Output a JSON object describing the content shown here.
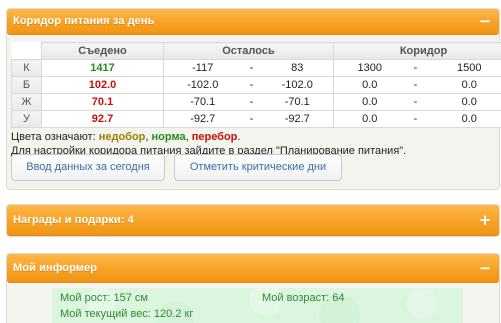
{
  "corridor_panel": {
    "title": "Коридор питания за день",
    "toggle": "−",
    "table": {
      "headers": {
        "eaten": "Съедено",
        "remaining": "Осталось",
        "corridor": "Коридор"
      },
      "rows": [
        {
          "label": "К",
          "eaten": "1417",
          "eaten_color": "#2a8a1c",
          "remaining_min": "-117",
          "remaining_sep": "-",
          "remaining_max": "83",
          "corridor_min": "1300",
          "corridor_sep": "-",
          "corridor_max": "1500"
        },
        {
          "label": "Б",
          "eaten": "102.0",
          "eaten_color": "#c80f0f",
          "remaining_min": "-102.0",
          "remaining_sep": "-",
          "remaining_max": "-102.0",
          "corridor_min": "0.0",
          "corridor_sep": "-",
          "corridor_max": "0.0"
        },
        {
          "label": "Ж",
          "eaten": "70.1",
          "eaten_color": "#c80f0f",
          "remaining_min": "-70.1",
          "remaining_sep": "-",
          "remaining_max": "-70.1",
          "corridor_min": "0.0",
          "corridor_sep": "-",
          "corridor_max": "0.0"
        },
        {
          "label": "У",
          "eaten": "92.7",
          "eaten_color": "#c80f0f",
          "remaining_min": "-92.7",
          "remaining_sep": "-",
          "remaining_max": "-92.7",
          "corridor_min": "0.0",
          "corridor_sep": "-",
          "corridor_max": "0.0"
        }
      ]
    },
    "legend": {
      "prefix": "Цвета означают: ",
      "under": "недобор",
      "sep1": ", ",
      "norm": "норма",
      "sep2": ", ",
      "over": "перебор",
      "suffix": "."
    },
    "hint": "Для настройки коридора питания зайдите в раздел \"Планирование питания\".",
    "buttons": {
      "today": "Ввод данных за сегодня",
      "critical": "Отметить критические дни"
    }
  },
  "awards_panel": {
    "title": "Награды и подарки: 4",
    "toggle": "+"
  },
  "informer_panel": {
    "title": "Мой информер",
    "toggle": "−",
    "height": "Мой рост: 157 см",
    "age": "Мой возраст: 64",
    "weight": "Мой текущий вес: 120.2 кг"
  },
  "colors": {
    "header_orange": "#f7a226",
    "under": "#9a7f00",
    "norm": "#2a8a1c",
    "over": "#c80f0f",
    "link_blue": "#3a6ea8",
    "informer_text": "#2f8a2f"
  },
  "icons": {
    "collapse": "minus-icon",
    "expand": "plus-icon"
  }
}
